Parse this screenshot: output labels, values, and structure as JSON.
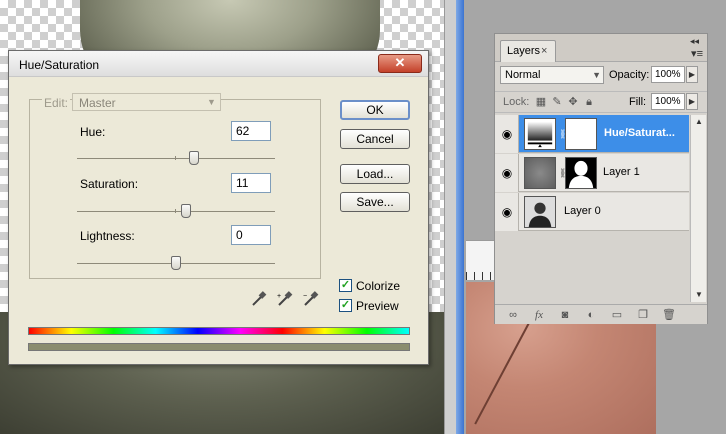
{
  "dialog": {
    "title": "Hue/Saturation",
    "close_glyph": "✕",
    "edit_label": "Edit:",
    "edit_value": "Master",
    "hue_label": "Hue:",
    "hue_value": "62",
    "hue_level": 0.59,
    "saturation_label": "Saturation:",
    "saturation_value": "11",
    "saturation_level": 0.55,
    "lightness_label": "Lightness:",
    "lightness_value": "0",
    "lightness_level": 0.5,
    "ok_label": "OK",
    "cancel_label": "Cancel",
    "load_label": "Load...",
    "save_label": "Save...",
    "colorize_label": "Colorize",
    "colorize_checked": true,
    "preview_label": "Preview",
    "preview_checked": true,
    "result_color": "#8b8d6f"
  },
  "layers": {
    "tab_label": "Layers",
    "tab_close": "×",
    "blend_mode": "Normal",
    "opacity_label": "Opacity:",
    "opacity_value": "100%",
    "lock_label": "Lock:",
    "fill_label": "Fill:",
    "fill_value": "100%",
    "items": [
      {
        "name": "Hue/Saturat...",
        "selected": true
      },
      {
        "name": "Layer 1",
        "selected": false
      },
      {
        "name": "Layer 0",
        "selected": false
      }
    ],
    "accent_color": "#3d8ee8"
  }
}
